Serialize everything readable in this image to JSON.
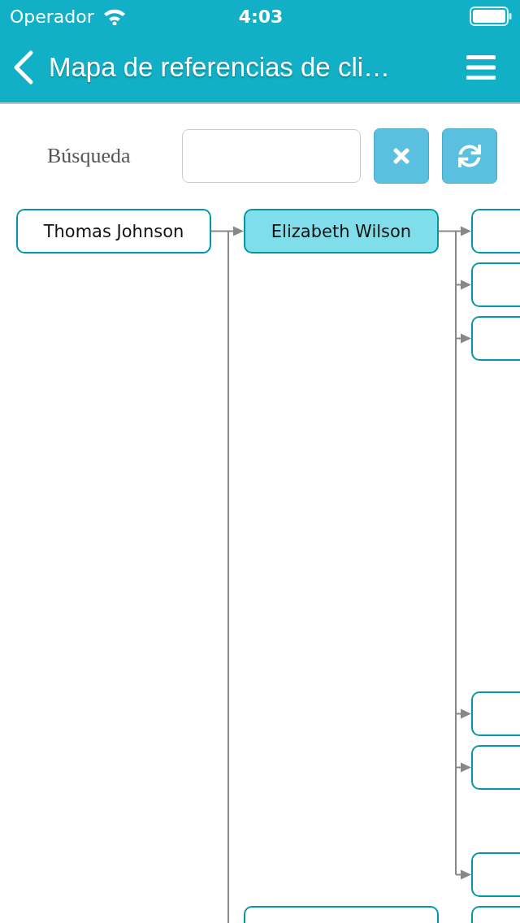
{
  "status_bar": {
    "carrier": "Operador",
    "time": "4:03"
  },
  "nav": {
    "title": "Mapa de referencias de cli…"
  },
  "search": {
    "label": "Búsqueda"
  },
  "tree": {
    "name": "Thomas Johnson",
    "selected": false,
    "children": [
      {
        "name": "Elizabeth Wilson",
        "selected": true,
        "children": [
          {
            "selected": false
          },
          {
            "selected": false
          },
          {
            "selected": false
          },
          {
            "selected": false
          },
          {
            "selected": false
          },
          {
            "selected": false
          }
        ]
      },
      {
        "selected": false,
        "children": [
          {
            "selected": false
          }
        ]
      }
    ]
  }
}
